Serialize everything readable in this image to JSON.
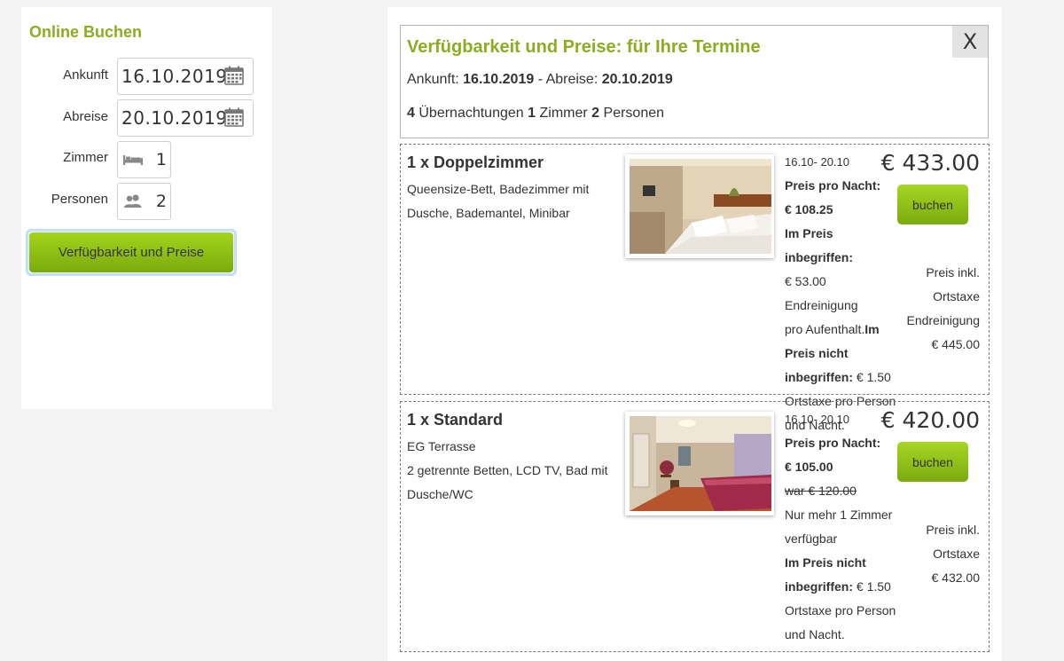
{
  "booking_form": {
    "title": "Online Buchen",
    "arrival_label": "Ankunft",
    "arrival_value": "16.10.2019",
    "departure_label": "Abreise",
    "departure_value": "20.10.2019",
    "rooms_label": "Zimmer",
    "rooms_value": "1",
    "persons_label": "Personen",
    "persons_value": "2",
    "submit_label": "Verfügbarkeit und Preise"
  },
  "results": {
    "title": "Verfügbarkeit und Preise: für Ihre Termine",
    "close_label": "X",
    "arrival_label": "Ankunft:",
    "arrival_value": "16.10.2019",
    "separator": "- Abreise:",
    "departure_value": "20.10.2019",
    "nights_value": "4",
    "nights_label": "Übernachtungen",
    "rooms_value": "1",
    "rooms_label": "Zimmer",
    "persons_value": "2",
    "persons_label": "Personen"
  },
  "rooms": [
    {
      "title": "1 x Doppelzimmer",
      "desc_1": "Queensize-Bett, Badezimmer mit",
      "desc_2": "Dusche, Bademantel, Minibar",
      "date_range": "16.10- 20.10",
      "per_night_label": "Preis pro Nacht:",
      "per_night_value": "€ 108.25",
      "included_label": "Im Preis inbegriffen:",
      "included_text_1": "€ 53.00 Endreinigung",
      "included_text_2": "pro Aufenthalt.",
      "not_included_label_1": "Im",
      "not_included_label_2": "Preis nicht",
      "not_included_label_3": "inbegriffen:",
      "not_included_value": "€ 1.50",
      "not_included_text_1": "Ortstaxe pro Person",
      "not_included_text_2": "und Nacht.",
      "total": "€ 433.00",
      "book_label": "buchen",
      "incl_1": "Preis inkl.",
      "incl_2": "Ortstaxe",
      "incl_3": "Endreinigung",
      "incl_4": "€ 445.00"
    },
    {
      "title": "1 x Standard",
      "desc_1": "EG Terrasse",
      "desc_2": "2 getrennte Betten, LCD TV, Bad mit",
      "desc_3": "Dusche/WC",
      "date_range": "16.10- 20.10",
      "per_night_label": "Preis pro Nacht:",
      "per_night_value": "€ 105.00",
      "old_price": "war € 120.00",
      "availability_1": "Nur mehr 1 Zimmer",
      "availability_2": "verfügbar",
      "not_included_label_1": "Im Preis nicht",
      "not_included_label_2": "inbegriffen:",
      "not_included_value": "€ 1.50",
      "not_included_text_1": "Ortstaxe pro Person",
      "not_included_text_2": "und Nacht.",
      "total": "€ 420.00",
      "book_label": "buchen",
      "incl_1": "Preis inkl.",
      "incl_2": "Ortstaxe",
      "incl_3": "€ 432.00"
    }
  ],
  "colors": {
    "accent_green": "#8cad1f",
    "button_green": "#79ab0d",
    "focus_ring": "#bfe0f7"
  },
  "icons": [
    "calendar-icon",
    "bed-icon",
    "persons-icon",
    "close-icon"
  ]
}
